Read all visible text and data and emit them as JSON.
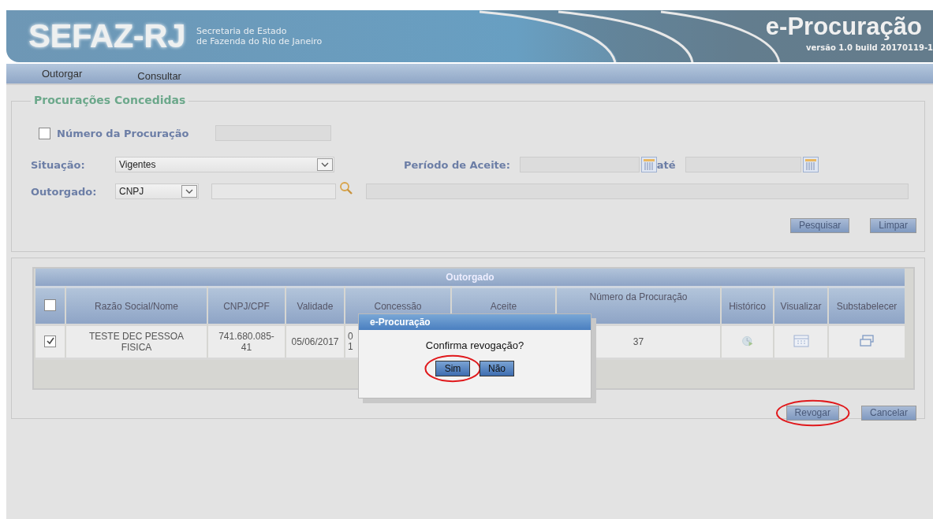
{
  "header": {
    "logo": "SEFAZ-RJ",
    "subtitle_lines": [
      "Secretaria de Estado",
      "de Fazenda do Rio de Janeiro"
    ],
    "app_title": "e-Procuração",
    "version": "versão 1.0 build 20170119-1"
  },
  "menu": [
    {
      "label": "Outorgar"
    },
    {
      "label": "Consultar"
    }
  ],
  "filters": {
    "legend": "Procurações Concedidas",
    "numero": {
      "label": "Número da Procuração",
      "checked": false
    },
    "situacao": {
      "label": "Situação:",
      "value": "Vigentes"
    },
    "periodo": {
      "label": "Período de Aceite:",
      "ate": "até"
    },
    "outorgado": {
      "label": "Outorgado:",
      "type": "CNPJ"
    },
    "buttons": [
      {
        "label": "Pesquisar",
        "highlighted": false
      },
      {
        "label": "Limpar",
        "highlighted": false
      }
    ]
  },
  "table": {
    "group": "Outorgado",
    "all_checked": false,
    "columns": [
      "Razão Social/Nome",
      "CNPJ/CPF",
      "Validade",
      "Concessão",
      "Aceite",
      "Número da Procuração",
      "Histórico",
      "Visualizar",
      "Substabelecer"
    ],
    "rows": [
      {
        "checked": true,
        "nome": "TESTE DEC PESSOA FISICA",
        "cnpj": "741.680.085-41",
        "validade": "05/06/2017",
        "concessao": [
          "0",
          "1"
        ],
        "numero": "37"
      }
    ]
  },
  "actions": [
    {
      "label": "Revogar",
      "highlighted": true
    },
    {
      "label": "Cancelar",
      "highlighted": false
    }
  ],
  "dialog": {
    "title": "e-Procuração",
    "message": "Confirma revogação?",
    "buttons": [
      {
        "label": "Sim",
        "highlighted": true
      },
      {
        "label": "Não",
        "highlighted": false
      }
    ]
  }
}
